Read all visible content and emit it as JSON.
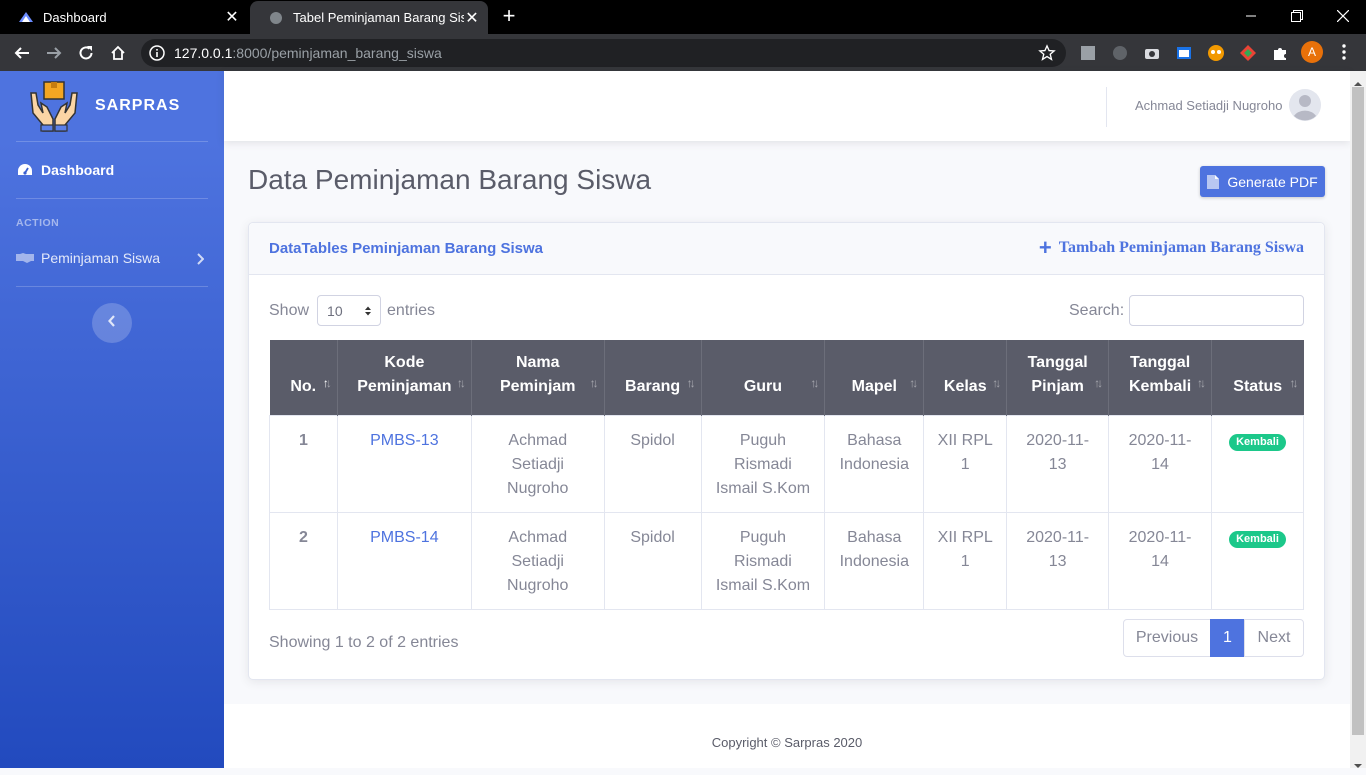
{
  "browser": {
    "tabs": [
      {
        "title": "Dashboard",
        "active": false
      },
      {
        "title": "Tabel Peminjaman Barang Siswa",
        "active": true
      }
    ],
    "url_host": "127.0.0.1",
    "url_path": ":8000/peminjaman_barang_siswa",
    "profile_initial": "A",
    "accent": "#e8710a"
  },
  "sidebar": {
    "brand": "SARPRAS",
    "dashboard_label": "Dashboard",
    "heading": "ACTION",
    "items": [
      {
        "label": "Peminjaman Siswa",
        "icon": "handshake-icon"
      }
    ]
  },
  "topbar": {
    "user_name": "Achmad Setiadji Nugroho"
  },
  "main": {
    "title": "Data Peminjaman Barang Siswa",
    "pdf_button": "Generate PDF",
    "card_title": "DataTables Peminjaman Barang Siswa",
    "add_link": "Tambah Peminjaman Barang Siswa",
    "show_label": "Show",
    "entries_label": "entries",
    "page_length": "10",
    "search_label": "Search:",
    "search_value": "",
    "columns": [
      [
        "No."
      ],
      [
        "Kode",
        "Peminjaman"
      ],
      [
        "Nama",
        "Peminjam"
      ],
      [
        "Barang"
      ],
      [
        "Guru"
      ],
      [
        "Mapel"
      ],
      [
        "Kelas"
      ],
      [
        "Tanggal",
        "Pinjam"
      ],
      [
        "Tanggal",
        "Kembali"
      ],
      [
        "Status"
      ]
    ],
    "rows": [
      {
        "no": "1",
        "kode": "PMBS-13",
        "nama": [
          "Achmad",
          "Setiadji",
          "Nugroho"
        ],
        "barang": "Spidol",
        "guru": [
          "Puguh",
          "Rismadi",
          "Ismail S.Kom"
        ],
        "mapel": [
          "Bahasa",
          "Indonesia"
        ],
        "kelas": [
          "XII RPL",
          "1"
        ],
        "tgl_pinjam": [
          "2020-11-",
          "13"
        ],
        "tgl_kembali": [
          "2020-11-",
          "14"
        ],
        "status": "Kembali"
      },
      {
        "no": "2",
        "kode": "PMBS-14",
        "nama": [
          "Achmad",
          "Setiadji",
          "Nugroho"
        ],
        "barang": "Spidol",
        "guru": [
          "Puguh",
          "Rismadi",
          "Ismail S.Kom"
        ],
        "mapel": [
          "Bahasa",
          "Indonesia"
        ],
        "kelas": [
          "XII RPL",
          "1"
        ],
        "tgl_pinjam": [
          "2020-11-",
          "13"
        ],
        "tgl_kembali": [
          "2020-11-",
          "14"
        ],
        "status": "Kembali"
      }
    ],
    "info": "Showing 1 to 2 of 2 entries",
    "pager": {
      "prev": "Previous",
      "current": "1",
      "next": "Next"
    }
  },
  "footer": {
    "copyright": "Copyright © Sarpras 2020"
  },
  "colors": {
    "primary": "#4e73df",
    "success": "#1cc88a",
    "header_dark": "#5a5c69"
  }
}
